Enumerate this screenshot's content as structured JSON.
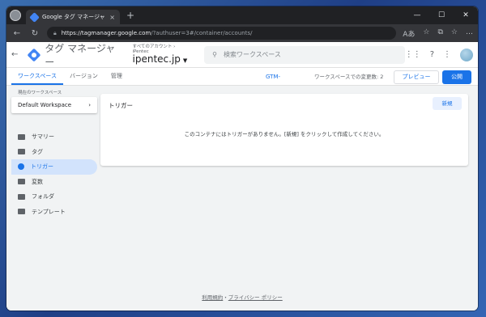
{
  "browser": {
    "tab_title": "Google タグ マネージャー",
    "tab_close": "×",
    "new_tab": "+",
    "url_host": "https://tagmanager.google.com",
    "url_path": "/?authuser=3#/container/accounts/",
    "controls": [
      "—",
      "☐",
      "✕"
    ],
    "nav": [
      "←",
      "↻"
    ],
    "right_icons": [
      "Aあ",
      "☆",
      "⧉",
      "☆",
      "…"
    ]
  },
  "header": {
    "back": "←",
    "product_name": "タグ マネージャー",
    "breadcrumb": "すべてのアカウント › iPentec",
    "container_name": "ipentec.jp",
    "caret": "▼",
    "search_placeholder": "検索ワークスペース",
    "icons": [
      "⋮⋮",
      "?",
      "⋮"
    ]
  },
  "subheader": {
    "tabs": [
      "ワークスペース",
      "バージョン",
      "管理"
    ],
    "gtm_id": "GTM-",
    "changes": "ワークスペースでの変更数: 2",
    "preview": "プレビュー",
    "publish": "公開"
  },
  "sidebar": {
    "workspace_label": "現在のワークスペース",
    "workspace_name": "Default Workspace",
    "chevron": "›",
    "items": [
      {
        "label": "サマリー",
        "active": false
      },
      {
        "label": "タグ",
        "active": false
      },
      {
        "label": "トリガー",
        "active": true
      },
      {
        "label": "変数",
        "active": false
      },
      {
        "label": "フォルダ",
        "active": false
      },
      {
        "label": "テンプレート",
        "active": false
      }
    ]
  },
  "main": {
    "title": "トリガー",
    "new_button": "新規",
    "empty_message": "このコンテナにはトリガーがありません。[新規] をクリックして作成してください。"
  },
  "footer": {
    "terms": "利用規約",
    "separator": "・",
    "privacy": "プライバシー ポリシー"
  }
}
